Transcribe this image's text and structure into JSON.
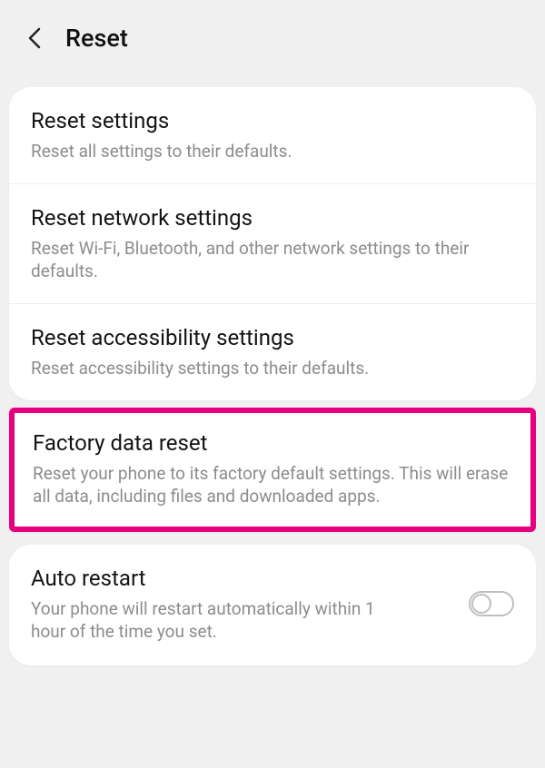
{
  "header": {
    "title": "Reset"
  },
  "items": [
    {
      "title": "Reset settings",
      "desc": "Reset all settings to their defaults."
    },
    {
      "title": "Reset network settings",
      "desc": "Reset Wi-Fi, Bluetooth, and other network settings to their defaults."
    },
    {
      "title": "Reset accessibility settings",
      "desc": "Reset accessibility settings to their defaults."
    },
    {
      "title": "Factory data reset",
      "desc": "Reset your phone to its factory default settings. This will erase all data, including files and downloaded apps."
    }
  ],
  "auto_restart": {
    "title": "Auto restart",
    "desc": "Your phone will restart automatically within 1 hour of the time you set.",
    "enabled": false
  },
  "highlight_index": 3,
  "colors": {
    "highlight": "#e6007e"
  }
}
